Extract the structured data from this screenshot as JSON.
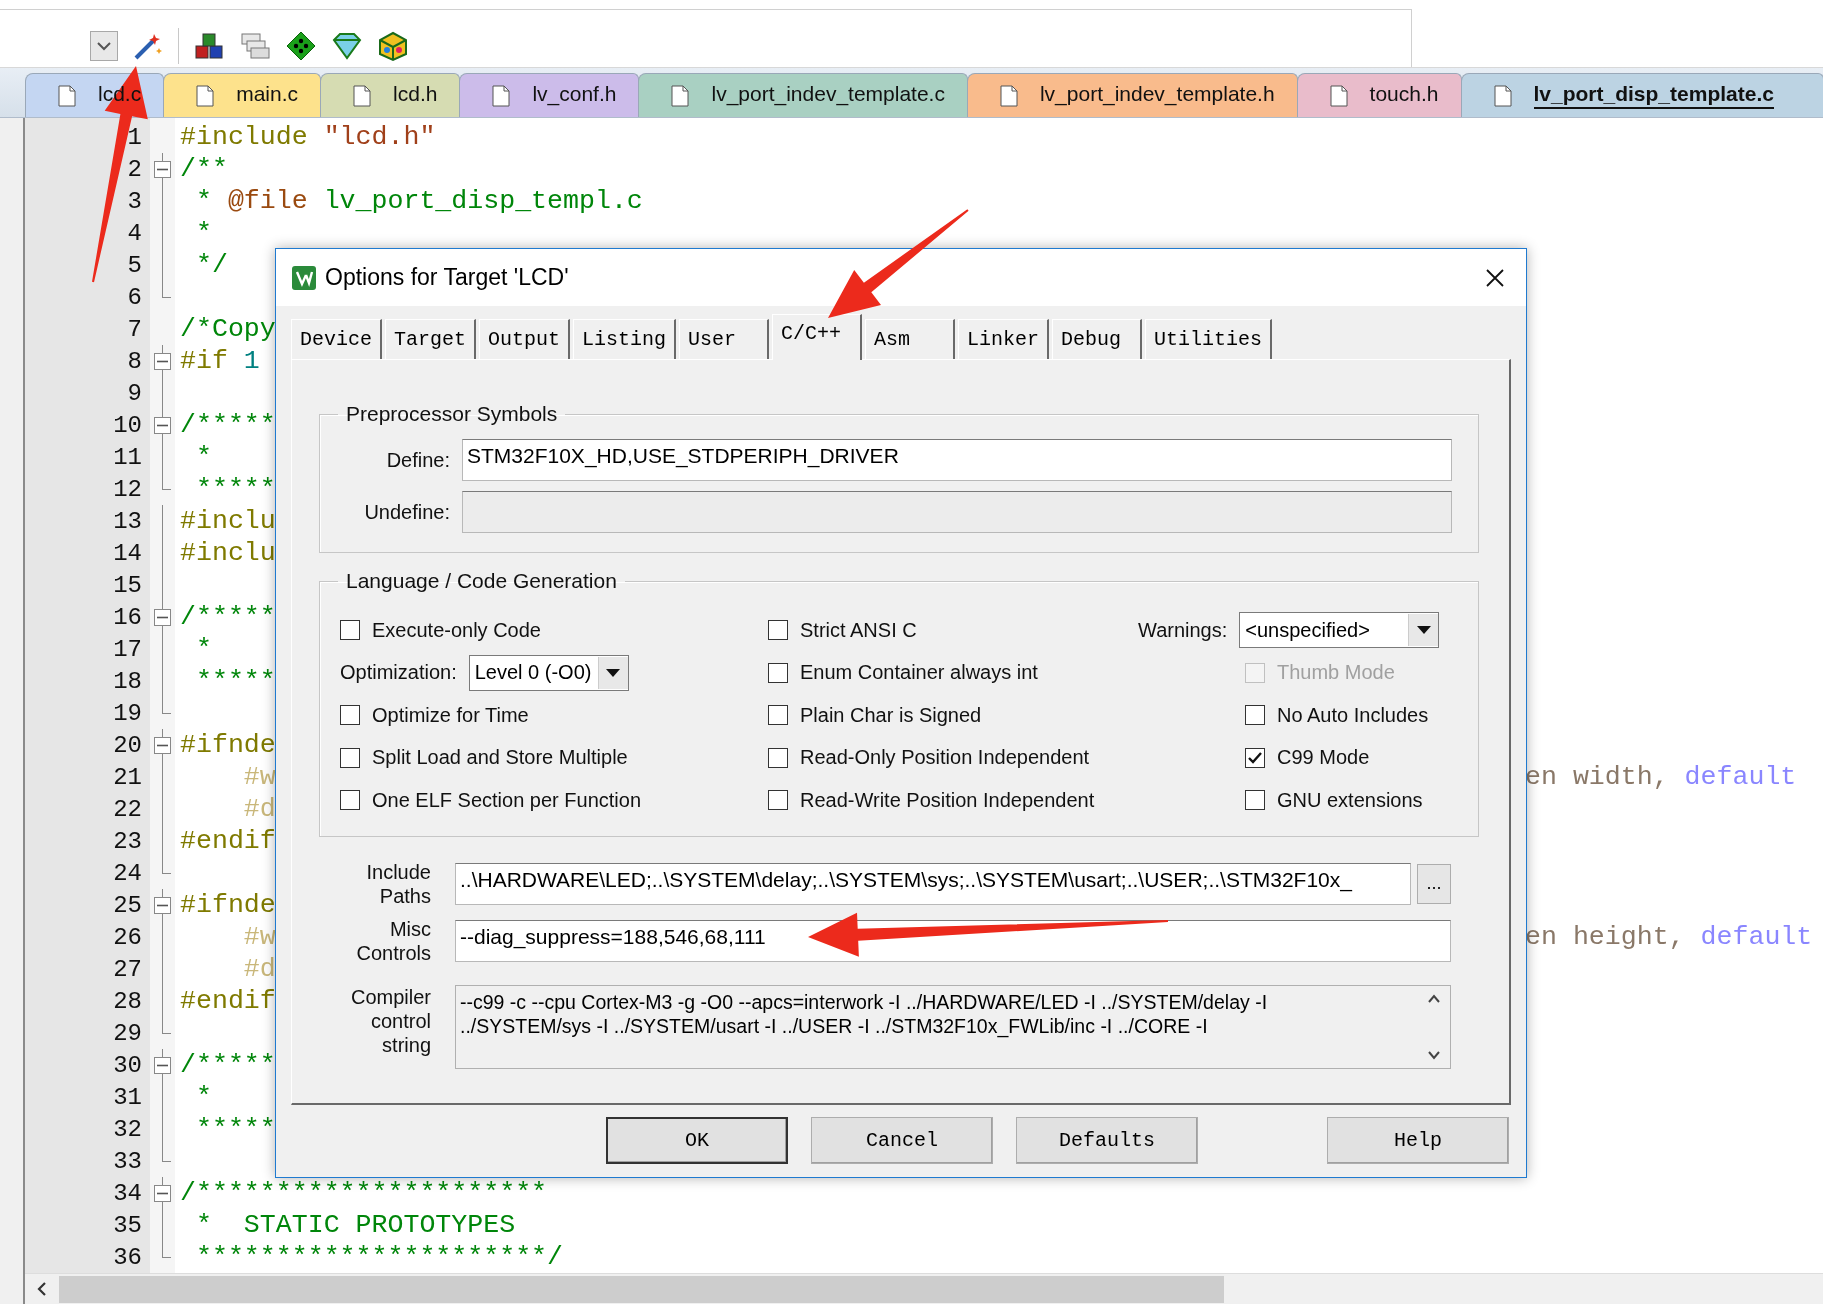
{
  "file_tabs": [
    {
      "label": "lcd.c",
      "color": "#c4d6f2",
      "selected": false
    },
    {
      "label": "main.c",
      "color": "#fde28c",
      "selected": false
    },
    {
      "label": "lcd.h",
      "color": "#d6dcb2",
      "selected": false
    },
    {
      "label": "lv_conf.h",
      "color": "#ccbcea",
      "selected": false
    },
    {
      "label": "lv_port_indev_template.c",
      "color": "#a9d0c2",
      "selected": false
    },
    {
      "label": "lv_port_indev_template.h",
      "color": "#f9bb8c",
      "selected": false
    },
    {
      "label": "touch.h",
      "color": "#e9bccb",
      "selected": false
    },
    {
      "label": "lv_port_disp_template.c",
      "color": "#bcd3e3",
      "selected": true
    }
  ],
  "editor": {
    "lines": [
      {
        "number": "1",
        "kind": "plain",
        "segments": [
          {
            "text": "#include ",
            "kind": "preproc"
          },
          {
            "text": "\"lcd.h\"",
            "kind": "string"
          }
        ]
      },
      {
        "number": "2",
        "kind": "foldstart",
        "segments": [
          {
            "text": "/**",
            "kind": "comment"
          }
        ]
      },
      {
        "number": "3",
        "kind": "foldline",
        "segments": [
          {
            "text": " * ",
            "kind": "comment"
          },
          {
            "text": "@file",
            "kind": "doctag"
          },
          {
            "text": " lv_port_disp_templ.c",
            "kind": "comment"
          }
        ]
      },
      {
        "number": "4",
        "kind": "foldline",
        "segments": [
          {
            "text": " *",
            "kind": "comment"
          }
        ]
      },
      {
        "number": "5",
        "kind": "foldline",
        "segments": [
          {
            "text": " */",
            "kind": "comment"
          }
        ]
      },
      {
        "number": "6",
        "kind": "foldend"
      },
      {
        "number": "7",
        "kind": "plain",
        "segments": [
          {
            "text": "/*Copy",
            "kind": "comment"
          }
        ]
      },
      {
        "number": "8",
        "kind": "foldstart",
        "segments": [
          {
            "text": "#if ",
            "kind": "preproc"
          },
          {
            "text": "1",
            "kind": "number"
          }
        ]
      },
      {
        "number": "9",
        "kind": "foldline"
      },
      {
        "number": "10",
        "kind": "foldstart",
        "segments": [
          {
            "text": "/*****",
            "kind": "comment"
          }
        ]
      },
      {
        "number": "11",
        "kind": "foldline",
        "segments": [
          {
            "text": " *",
            "kind": "comment"
          }
        ]
      },
      {
        "number": "12",
        "kind": "foldend",
        "segments": [
          {
            "text": " *****",
            "kind": "comment"
          }
        ]
      },
      {
        "number": "13",
        "kind": "foldline",
        "segments": [
          {
            "text": "#inclu",
            "kind": "preproc"
          }
        ]
      },
      {
        "number": "14",
        "kind": "foldline",
        "segments": [
          {
            "text": "#inclu",
            "kind": "preproc"
          }
        ]
      },
      {
        "number": "15",
        "kind": "foldline"
      },
      {
        "number": "16",
        "kind": "foldstart",
        "segments": [
          {
            "text": "/*****",
            "kind": "comment"
          }
        ]
      },
      {
        "number": "17",
        "kind": "foldline",
        "segments": [
          {
            "text": " *",
            "kind": "comment"
          }
        ]
      },
      {
        "number": "18",
        "kind": "foldline",
        "segments": [
          {
            "text": " *****",
            "kind": "comment"
          }
        ]
      },
      {
        "number": "19",
        "kind": "foldend"
      },
      {
        "number": "20",
        "kind": "foldstart",
        "segments": [
          {
            "text": "#ifnde",
            "kind": "preproc"
          }
        ]
      },
      {
        "number": "21",
        "kind": "foldline",
        "segments": [
          {
            "text": "    #w",
            "kind": "inactive"
          }
        ],
        "right_segments": [
          {
            "text": "en width, ",
            "kind": "inactive_text"
          },
          {
            "text": "default",
            "kind": "inactive_keyword"
          }
        ]
      },
      {
        "number": "22",
        "kind": "foldline",
        "segments": [
          {
            "text": "    #d",
            "kind": "inactive"
          }
        ]
      },
      {
        "number": "23",
        "kind": "foldline",
        "segments": [
          {
            "text": "#endif",
            "kind": "preproc"
          }
        ]
      },
      {
        "number": "24",
        "kind": "foldend"
      },
      {
        "number": "25",
        "kind": "foldstart",
        "segments": [
          {
            "text": "#ifnde",
            "kind": "preproc"
          }
        ]
      },
      {
        "number": "26",
        "kind": "foldline",
        "segments": [
          {
            "text": "    #w",
            "kind": "inactive"
          }
        ],
        "right_segments": [
          {
            "text": "en height, ",
            "kind": "inactive_text"
          },
          {
            "text": "default",
            "kind": "inactive_keyword"
          }
        ]
      },
      {
        "number": "27",
        "kind": "foldline",
        "segments": [
          {
            "text": "    #d",
            "kind": "inactive"
          }
        ]
      },
      {
        "number": "28",
        "kind": "foldline",
        "segments": [
          {
            "text": "#endif",
            "kind": "preproc"
          }
        ]
      },
      {
        "number": "29",
        "kind": "foldend"
      },
      {
        "number": "30",
        "kind": "foldstart",
        "segments": [
          {
            "text": "/*****",
            "kind": "comment"
          }
        ]
      },
      {
        "number": "31",
        "kind": "foldline",
        "segments": [
          {
            "text": " *",
            "kind": "comment"
          }
        ]
      },
      {
        "number": "32",
        "kind": "foldline",
        "segments": [
          {
            "text": " *****",
            "kind": "comment"
          }
        ]
      },
      {
        "number": "33",
        "kind": "foldend"
      },
      {
        "number": "34",
        "kind": "foldstart",
        "segments": [
          {
            "text": "/**********************",
            "kind": "comment"
          }
        ]
      },
      {
        "number": "35",
        "kind": "foldline",
        "segments": [
          {
            "text": " *  STATIC PROTOTYPES",
            "kind": "comment"
          }
        ]
      },
      {
        "number": "36",
        "kind": "foldend",
        "segments": [
          {
            "text": " **********************/",
            "kind": "comment"
          }
        ]
      }
    ]
  },
  "dialog": {
    "title": "Options for Target 'LCD'",
    "tabs": [
      {
        "label": "Device",
        "selected": false
      },
      {
        "label": "Target",
        "selected": false
      },
      {
        "label": "Output",
        "selected": false
      },
      {
        "label": "Listing",
        "selected": false
      },
      {
        "label": "User",
        "selected": false
      },
      {
        "label": "C/C++",
        "selected": true
      },
      {
        "label": "Asm",
        "selected": false
      },
      {
        "label": "Linker",
        "selected": false
      },
      {
        "label": "Debug",
        "selected": false
      },
      {
        "label": "Utilities",
        "selected": false
      }
    ],
    "preprocessor": {
      "title": "Preprocessor Symbols",
      "fields": [
        {
          "label": "Define:",
          "value": "STM32F10X_HD,USE_STDPERIPH_DRIVER",
          "disabled": false
        },
        {
          "label": "Undefine:",
          "disabled": true
        }
      ]
    },
    "language": {
      "title": "Language / Code Generation",
      "columns": [
        [
          {
            "kind": "checkbox",
            "label": "Execute-only Code",
            "checked": false,
            "disabled": false
          },
          {
            "kind": "select",
            "label": "Optimization:",
            "value": "Level 0 (-O0)"
          },
          {
            "kind": "checkbox",
            "label": "Optimize for Time",
            "checked": false,
            "disabled": false
          },
          {
            "kind": "checkbox",
            "label": "Split Load and Store Multiple",
            "checked": false,
            "disabled": false
          },
          {
            "kind": "checkbox",
            "label": "One ELF Section per Function",
            "checked": false,
            "disabled": false
          }
        ],
        [
          {
            "kind": "checkbox",
            "label": "Strict ANSI C",
            "checked": false,
            "disabled": false
          },
          {
            "kind": "checkbox",
            "label": "Enum Container always int",
            "checked": false,
            "disabled": false
          },
          {
            "kind": "checkbox",
            "label": "Plain Char is Signed",
            "checked": false,
            "disabled": false
          },
          {
            "kind": "checkbox",
            "label": "Read-Only Position Independent",
            "checked": false,
            "disabled": false
          },
          {
            "kind": "checkbox",
            "label": "Read-Write Position Independent",
            "checked": false,
            "disabled": false
          }
        ],
        [
          {
            "kind": "select",
            "label": "Warnings:",
            "value": "<unspecified>"
          },
          {
            "kind": "checkbox",
            "label": "Thumb Mode",
            "checked": false,
            "disabled": true
          },
          {
            "kind": "checkbox",
            "label": "No Auto Includes",
            "checked": false,
            "disabled": false
          },
          {
            "kind": "checkbox",
            "label": "C99 Mode",
            "checked": true,
            "disabled": false
          },
          {
            "kind": "checkbox",
            "label": "GNU extensions",
            "checked": false,
            "disabled": false
          }
        ]
      ]
    },
    "include_paths": {
      "label": "Include Paths",
      "value": "..\\HARDWARE\\LED;..\\SYSTEM\\delay;..\\SYSTEM\\sys;..\\SYSTEM\\usart;..\\USER;..\\STM32F10x_",
      "browse": "..."
    },
    "misc_controls": {
      "label": "Misc Controls",
      "value": "--diag_suppress=188,546,68,111"
    },
    "compiler_string": {
      "label": "Compiler control string",
      "lines": [
        "--c99 -c --cpu Cortex-M3 -g -O0 --apcs=interwork -I ../HARDWARE/LED -I ../SYSTEM/delay -I",
        "../SYSTEM/sys -I ../SYSTEM/usart -I ../USER -I ../STM32F10x_FWLib/inc -I ../CORE -I"
      ]
    },
    "buttons": [
      {
        "label": "OK",
        "default": true
      },
      {
        "label": "Cancel",
        "default": false
      },
      {
        "label": "Defaults",
        "default": false
      },
      {
        "label": "Help",
        "default": false
      }
    ]
  }
}
